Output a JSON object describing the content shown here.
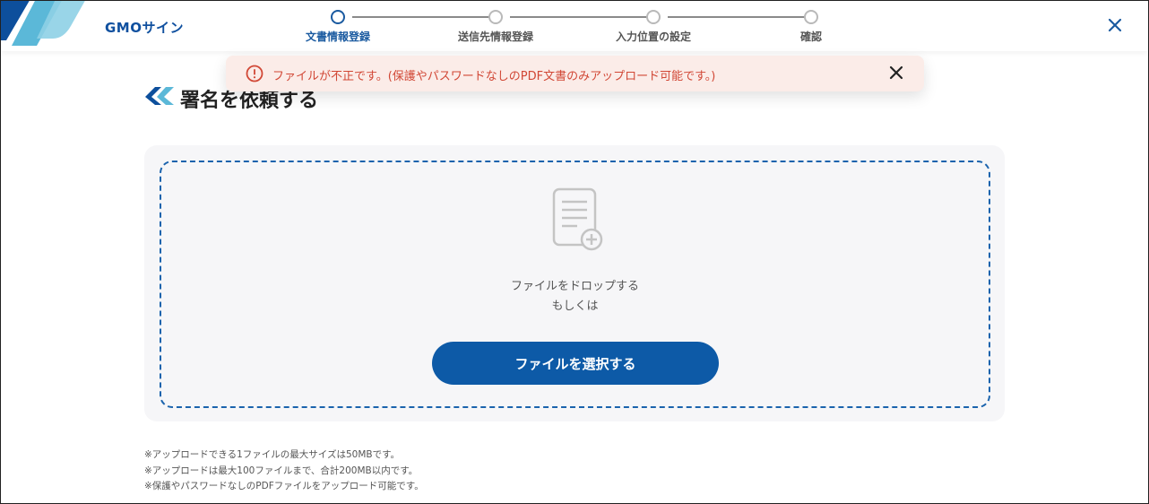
{
  "header": {
    "brand": "GMOサイン",
    "steps": [
      {
        "label": "文書情報登録",
        "active": true
      },
      {
        "label": "送信先情報登録",
        "active": false
      },
      {
        "label": "入力位置の設定",
        "active": false
      },
      {
        "label": "確認",
        "active": false
      }
    ],
    "close_icon": "close-icon",
    "accent_color": "#1a5aa0"
  },
  "toast": {
    "message": "ファイルが不正です。(保護やパスワードなしのPDF文書のみアップロード可能です。)",
    "icon": "alert-circle-icon",
    "color": "#d14735"
  },
  "page": {
    "title": "署名を依頼する"
  },
  "dropzone": {
    "line1": "ファイルをドロップする",
    "line2": "もしくは",
    "button_label": "ファイルを選択する"
  },
  "notes": [
    "※アップロードできる1ファイルの最大サイズは50MBです。",
    "※アップロードは最大100ファイルまで、合計200MB以内です。",
    "※保護やパスワードなしのPDFファイルをアップロード可能です。"
  ]
}
